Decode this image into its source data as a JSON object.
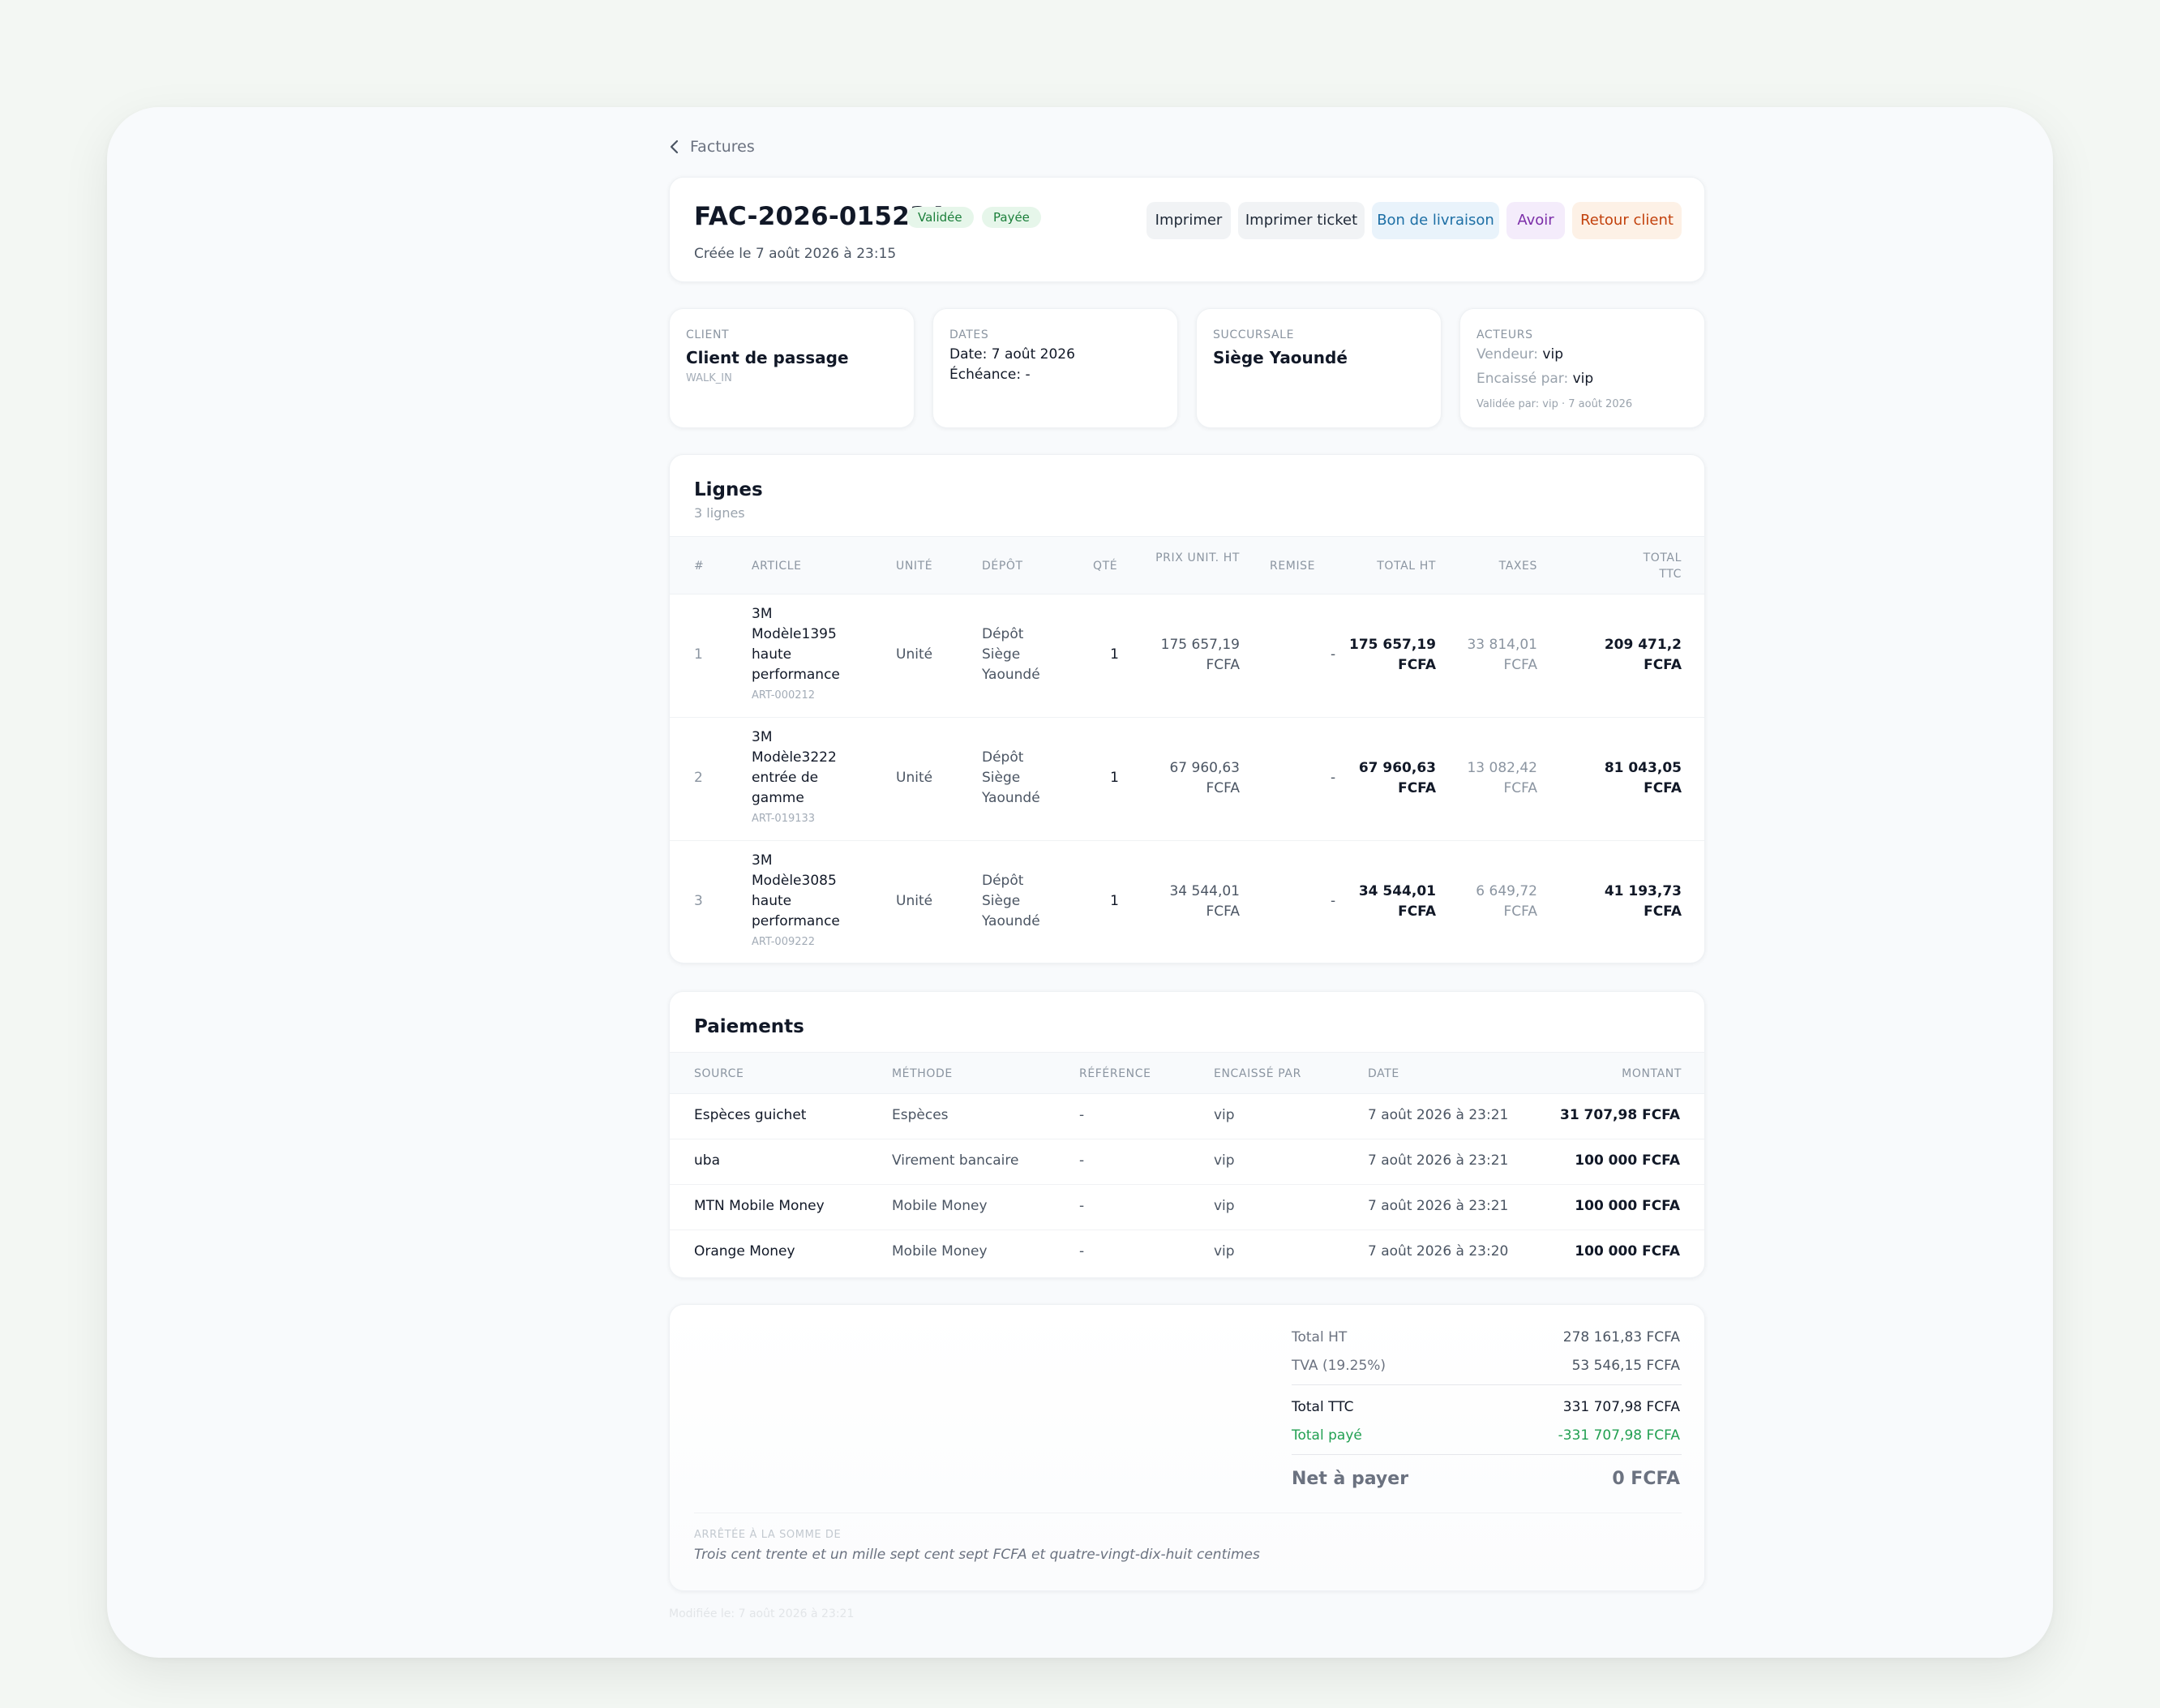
{
  "nav": {
    "back_label": "Factures"
  },
  "invoice": {
    "number": "FAC-2026-015234",
    "badges": [
      "Validée",
      "Payée"
    ],
    "created": "Créée le 7 août 2026 à 23:15"
  },
  "actions": [
    "Imprimer",
    "Imprimer ticket",
    "Bon de livraison",
    "Avoir",
    "Retour client"
  ],
  "info": {
    "client": {
      "label": "CLIENT",
      "name": "Client de passage",
      "code": "WALK_IN"
    },
    "dates": {
      "label": "DATES",
      "date": "Date: 7 août 2026",
      "due": "Échéance: -"
    },
    "branch": {
      "label": "SUCCURSALE",
      "name": "Siège Yaoundé"
    },
    "actors": {
      "label": "ACTEURS",
      "seller_label": "Vendeur:",
      "seller": "vip",
      "cashier_label": "Encaissé par:",
      "cashier": "vip",
      "validated": "Validée par: vip · 7 août 2026"
    }
  },
  "lines": {
    "title": "Lignes",
    "subtitle": "3 lignes",
    "headers": [
      "#",
      "ARTICLE",
      "UNITÉ",
      "DÉPÔT",
      "QTÉ",
      "PRIX UNIT. HT",
      "REMISE",
      "TOTAL HT",
      "TAXES",
      "TOTAL TTC"
    ],
    "rows": [
      {
        "n": "1",
        "article": "3M Modèle1395 haute performance",
        "sku": "ART-000212",
        "unit": "Unité",
        "depot": "Dépôt Siège Yaoundé",
        "qty": "1",
        "price": "175 657,19 FCFA",
        "discount": "-",
        "total_ht": "175 657,19 FCFA",
        "taxes": "33 814,01 FCFA",
        "total_ttc": "209 471,2 FCFA"
      },
      {
        "n": "2",
        "article": "3M Modèle3222 entrée de gamme",
        "sku": "ART-019133",
        "unit": "Unité",
        "depot": "Dépôt Siège Yaoundé",
        "qty": "1",
        "price": "67 960,63 FCFA",
        "discount": "-",
        "total_ht": "67 960,63 FCFA",
        "taxes": "13 082,42 FCFA",
        "total_ttc": "81 043,05 FCFA"
      },
      {
        "n": "3",
        "article": "3M Modèle3085 haute performance",
        "sku": "ART-009222",
        "unit": "Unité",
        "depot": "Dépôt Siège Yaoundé",
        "qty": "1",
        "price": "34 544,01 FCFA",
        "discount": "-",
        "total_ht": "34 544,01 FCFA",
        "taxes": "6 649,72 FCFA",
        "total_ttc": "41 193,73 FCFA"
      }
    ]
  },
  "payments": {
    "title": "Paiements",
    "headers": [
      "SOURCE",
      "MÉTHODE",
      "RÉFÉRENCE",
      "ENCAISSÉ PAR",
      "DATE",
      "MONTANT"
    ],
    "rows": [
      {
        "source": "Espèces guichet",
        "method": "Espèces",
        "ref": "-",
        "by": "vip",
        "date": "7 août 2026 à 23:21",
        "amount": "31 707,98 FCFA"
      },
      {
        "source": "uba",
        "method": "Virement bancaire",
        "ref": "-",
        "by": "vip",
        "date": "7 août 2026 à 23:21",
        "amount": "100 000 FCFA"
      },
      {
        "source": "MTN Mobile Money",
        "method": "Mobile Money",
        "ref": "-",
        "by": "vip",
        "date": "7 août 2026 à 23:21",
        "amount": "100 000 FCFA"
      },
      {
        "source": "Orange Money",
        "method": "Mobile Money",
        "ref": "-",
        "by": "vip",
        "date": "7 août 2026 à 23:20",
        "amount": "100 000 FCFA"
      }
    ]
  },
  "totals": {
    "ht_label": "Total HT",
    "ht": "278 161,83 FCFA",
    "tva_label": "TVA (19.25%)",
    "tva": "53 546,15 FCFA",
    "ttc_label": "Total TTC",
    "ttc": "331 707,98 FCFA",
    "paid_label": "Total payé",
    "paid": "-331 707,98 FCFA",
    "net_label": "Net à payer",
    "net": "0 FCFA",
    "words_label": "ARRÊTÉE À LA SOMME DE",
    "words": "Trois cent trente et un mille sept cent sept FCFA et quatre-vingt-dix-huit centimes"
  },
  "footer": "Modifiée le: 7 août 2026 à 23:21",
  "colors": {
    "accent_green": "#1b7f3a",
    "paid_green": "#22a052",
    "link_blue": "#1d6fa5"
  }
}
